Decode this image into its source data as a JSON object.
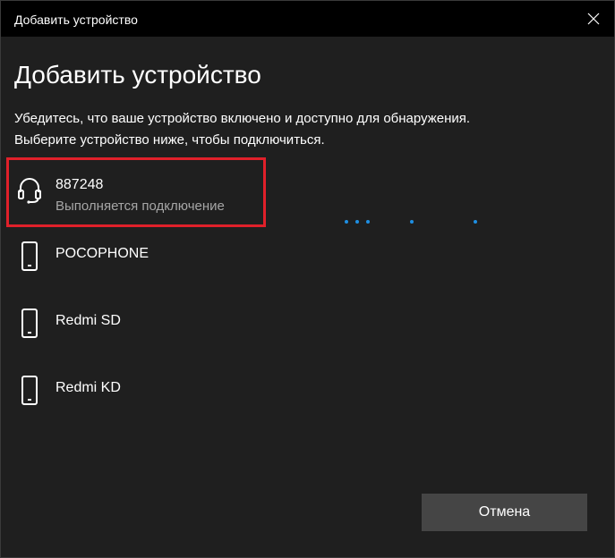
{
  "window": {
    "title": "Добавить устройство"
  },
  "heading": "Добавить устройство",
  "description": {
    "line1": "Убедитесь, что ваше устройство включено и доступно для обнаружения.",
    "line2": "Выберите устройство ниже, чтобы подключиться."
  },
  "devices": [
    {
      "name": "887248",
      "status": "Выполняется подключение",
      "icon": "headset-icon"
    },
    {
      "name": "POCOPHONE",
      "icon": "phone-icon"
    },
    {
      "name": "Redmi SD",
      "icon": "phone-icon"
    },
    {
      "name": "Redmi KD",
      "icon": "phone-icon"
    }
  ],
  "buttons": {
    "cancel": "Отмена"
  },
  "colors": {
    "background": "#1f1f1f",
    "titlebar": "#000000",
    "accent": "#1e8fe3",
    "highlight": "#e0202a",
    "button": "#454545"
  },
  "icons": {
    "close": "close-icon",
    "progress": "progress-dots"
  }
}
